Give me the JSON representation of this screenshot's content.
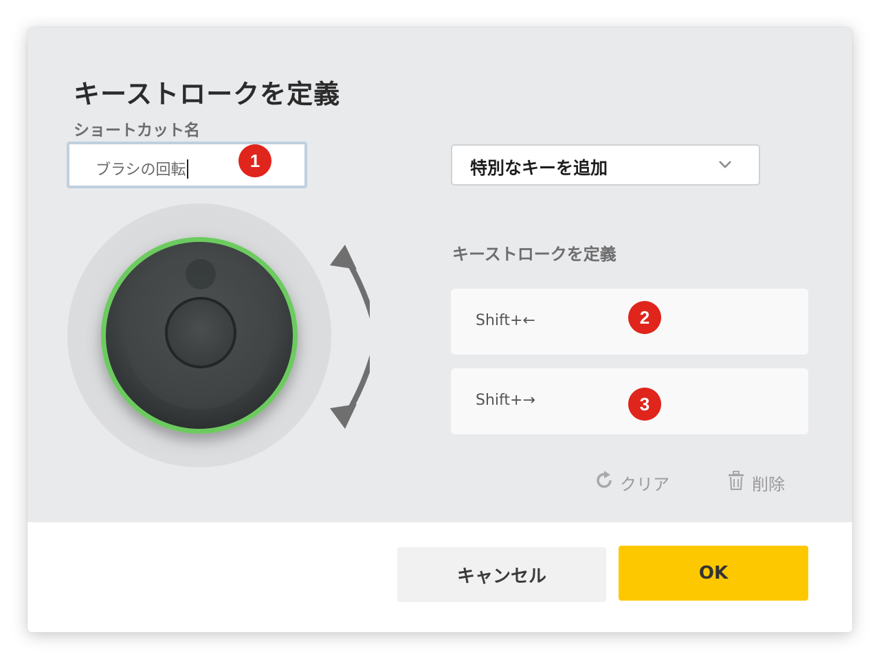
{
  "dialog": {
    "title": "キーストロークを定義",
    "shortcut_name_label": "ショートカット名",
    "shortcut_name_value": "ブラシの回転",
    "special_key_dropdown": {
      "selected": "特別なキーを追加",
      "icon": "chevron-down-icon"
    },
    "keystroke_heading": "キーストロークを定義",
    "keystrokes": [
      {
        "value": "Shift+←",
        "badge": "2"
      },
      {
        "value": "Shift+→",
        "badge": "3"
      }
    ],
    "name_badge": "1",
    "clear_label": "クリア",
    "clear_icon": "refresh-icon",
    "delete_label": "削除",
    "delete_icon": "trash-icon",
    "dial": {
      "ring_color": "#6ccb5f",
      "icon": "rotary-dial-icon",
      "arrows": "rotate-arrows-icon"
    }
  },
  "footer": {
    "cancel_label": "キャンセル",
    "ok_label": "OK",
    "ok_color": "#fec800"
  },
  "colors": {
    "badge": "#e0251c",
    "panel_bg": "#e9eaec"
  }
}
